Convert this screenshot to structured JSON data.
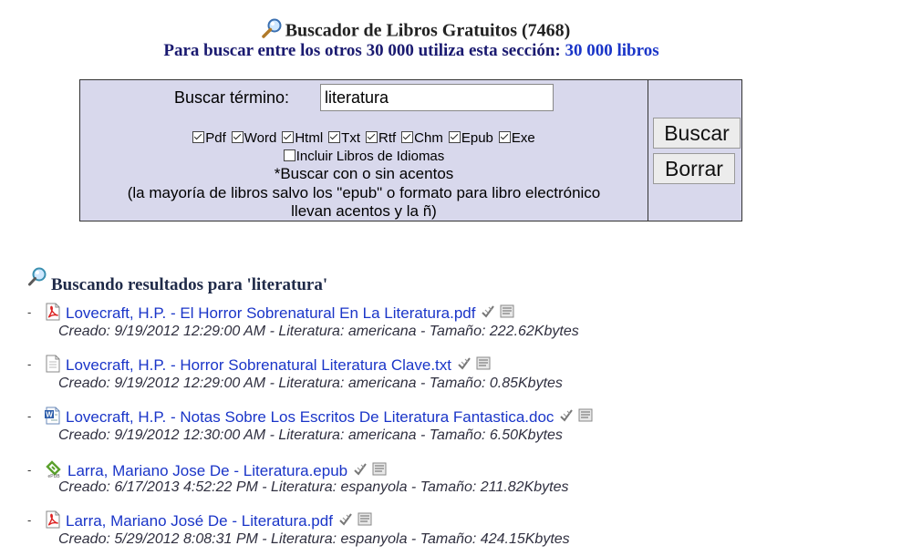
{
  "header": {
    "title": "Buscador de Libros Gratuitos (7468)",
    "subtitle": "Para buscar entre los otros 30 000 utiliza esta sección:",
    "subtitle_link": "30 000 libros"
  },
  "search": {
    "term_label": "Buscar término:",
    "term_value": "literatura",
    "formats": [
      {
        "label": "Pdf",
        "checked": true
      },
      {
        "label": "Word",
        "checked": true
      },
      {
        "label": "Html",
        "checked": true
      },
      {
        "label": "Txt",
        "checked": true
      },
      {
        "label": "Rtf",
        "checked": true
      },
      {
        "label": "Chm",
        "checked": true
      },
      {
        "label": "Epub",
        "checked": true
      },
      {
        "label": "Exe",
        "checked": true
      }
    ],
    "idiomas_label": "Incluir Libros de Idiomas",
    "note1": "*Buscar con o sin acentos",
    "note2": "(la mayoría de libros salvo los \"epub\" o formato para libro electrónico",
    "note3": "llevan acentos y la ñ)",
    "buscar_label": "Buscar",
    "borrar_label": "Borrar"
  },
  "results": {
    "title": "Buscando resultados para 'literatura'",
    "items": [
      {
        "icon": "pdf-icon",
        "title": "Lovecraft, H.P. - El Horror Sobrenatural En La Literatura.pdf",
        "meta": "Creado: 9/19/2012 12:29:00 AM - Literatura: americana - Tamaño: 222.62Kbytes"
      },
      {
        "icon": "txt-icon",
        "title": "Lovecraft, H.P. - Horror Sobrenatural Literatura Clave.txt",
        "meta": "Creado: 9/19/2012 12:29:00 AM - Literatura: americana - Tamaño: 0.85Kbytes"
      },
      {
        "icon": "word-icon",
        "title": "Lovecraft, H.P. - Notas Sobre Los Escritos De Literatura Fantastica.doc",
        "meta": "Creado: 9/19/2012 12:30:00 AM - Literatura: americana - Tamaño: 6.50Kbytes"
      },
      {
        "icon": "epub-icon",
        "title": "Larra, Mariano Jose De - Literatura.epub",
        "meta": "Creado: 6/17/2013 4:52:22 PM - Literatura: espanyola - Tamaño: 211.82Kbytes"
      },
      {
        "icon": "pdf-icon",
        "title": "Larra, Mariano José De - Literatura.pdf",
        "meta": "Creado: 5/29/2012 8:08:31 PM - Literatura: espanyola - Tamaño: 424.15Kbytes"
      }
    ]
  }
}
